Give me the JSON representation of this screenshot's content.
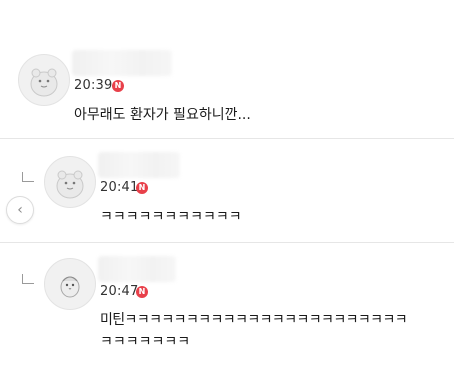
{
  "comments": [
    {
      "time": "20:39",
      "badge": "N",
      "text": "아무래도 환자가 필요하니깐..."
    },
    {
      "time": "20:41",
      "badge": "N",
      "text": "ㅋㅋㅋㅋㅋㅋㅋㅋㅋㅋㅋ"
    },
    {
      "time": "20:47",
      "badge": "N",
      "text_line1": "미틴ㅋㅋㅋㅋㅋㅋㅋㅋㅋㅋㅋㅋㅋㅋㅋㅋㅋㅋㅋㅋㅋㅋㅋ",
      "text_line2": "ㅋㅋㅋㅋㅋㅋㅋ"
    }
  ],
  "nav": {
    "prev_icon": "chevron-left-icon"
  },
  "colors": {
    "badge": "#e8404a",
    "divider": "#e6e6e6"
  }
}
